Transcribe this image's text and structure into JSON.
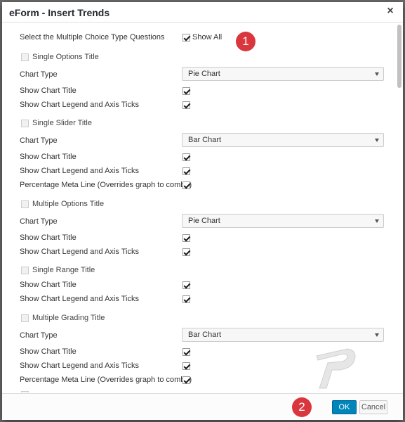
{
  "dialog": {
    "title": "eForm - Insert Trends",
    "close_icon": "close-icon"
  },
  "header_row": {
    "label": "Select the Multiple Choice Type Questions",
    "show_all_label": "Show All",
    "show_all_checked": true
  },
  "sections": [
    {
      "title": "Single Options Title",
      "chart_type": "Pie Chart",
      "show_chart_title": true,
      "show_legend": true,
      "has_meta_line": false
    },
    {
      "title": "Single Slider Title",
      "chart_type": "Bar Chart",
      "show_chart_title": true,
      "show_legend": true,
      "has_meta_line": true,
      "meta_line": true
    },
    {
      "title": "Multiple Options Title",
      "chart_type": "Pie Chart",
      "show_chart_title": true,
      "show_legend": true,
      "has_meta_line": false
    },
    {
      "title": "Single Range Title",
      "chart_type": null,
      "show_chart_title": true,
      "show_legend": true,
      "has_meta_line": false
    },
    {
      "title": "Multiple Grading Title",
      "chart_type": "Bar Chart",
      "show_chart_title": true,
      "show_legend": true,
      "has_meta_line": true,
      "meta_line": true
    }
  ],
  "labels": {
    "chart_type": "Chart Type",
    "show_chart_title": "Show Chart Title",
    "show_legend": "Show Chart Legend and Axis Ticks",
    "meta_line": "Percentage Meta Line (Overrides graph to combo)"
  },
  "annotations": {
    "badge1": "1",
    "badge2": "2"
  },
  "footer": {
    "ok_label": "OK",
    "cancel_label": "Cancel"
  },
  "colors": {
    "primary": "#0085ba",
    "badge": "#d9363e"
  }
}
